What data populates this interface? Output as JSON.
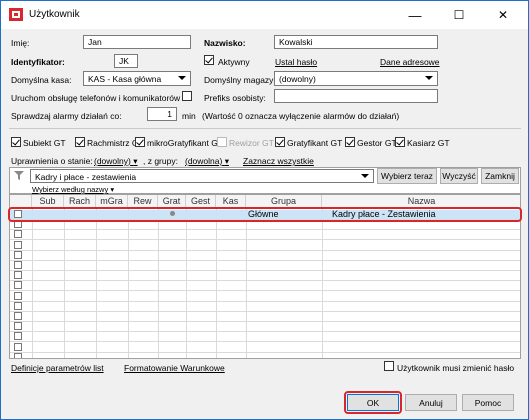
{
  "window": {
    "title": "Użytkownik",
    "minimize": "—",
    "maximize": "☐",
    "close": "✕"
  },
  "form": {
    "imie_label": "Imię:",
    "imie_value": "Jan",
    "nazwisko_label": "Nazwisko:",
    "nazwisko_value": "Kowalski",
    "identyfikator_label": "Identyfikator:",
    "identyfikator_value": "JK",
    "aktywny_label": "Aktywny",
    "ustal_haslo": "Ustal hasło",
    "dane_adresowe": "Dane adresowe",
    "kasa_label": "Domyślna kasa:",
    "kasa_value": "KAS - Kasa główna",
    "magazyn_label": "Domyślny magazyn:",
    "magazyn_value": "(dowolny)",
    "telefonia_label": "Uruchom obsługę telefonów i komunikatorów",
    "prefiks_label": "Prefiks osobisty:",
    "alarmy_label": "Sprawdzaj alarmy działań co:",
    "alarmy_value": "1",
    "alarmy_unit": "min",
    "alarmy_note": "(Wartość 0 oznacza wyłączenie alarmów do działań)"
  },
  "modules": [
    {
      "label": "Subiekt GT",
      "checked": true,
      "disabled": false
    },
    {
      "label": "Rachmistrz GT",
      "checked": true,
      "disabled": false
    },
    {
      "label": "mikroGratyfikant GT",
      "checked": true,
      "disabled": false
    },
    {
      "label": "Rewizor GT",
      "checked": false,
      "disabled": true
    },
    {
      "label": "Gratyfikant GT",
      "checked": true,
      "disabled": false
    },
    {
      "label": "Gestor GT",
      "checked": true,
      "disabled": false
    },
    {
      "label": "Kasiarz GT",
      "checked": true,
      "disabled": false
    }
  ],
  "permissions": {
    "stan_label": "Uprawnienia o stanie:",
    "stan_value": "(dowolny)",
    "grupa_label": ", z grupy:",
    "grupa_value": "(dowolna)",
    "zaznacz": "Zaznacz wszystkie",
    "filter_value": "Kadry i płace - zestawienia",
    "wybierz_teraz": "Wybierz teraz",
    "wyczysc": "Wyczyść",
    "zamknij": "Zamknij",
    "wybierz_wedlug": "Wybierz według nazwy"
  },
  "grid": {
    "columns": [
      "Sub",
      "Rach",
      "mGra",
      "Rew",
      "Grat",
      "Gest",
      "Kas",
      "Grupa",
      "Nazwa"
    ],
    "rows": [
      {
        "grupa": "Główne",
        "nazwa": "Kadry płace - Zestawienia"
      }
    ],
    "empty_rows": 14
  },
  "footer": {
    "definicje": "Definicje parametrów list",
    "formatowanie": "Formatowanie Warunkowe",
    "musi_zmienic": "Użytkownik musi zmienić hasło",
    "ok": "OK",
    "anuluj": "Anuluj",
    "pomoc": "Pomoc"
  },
  "colors": {
    "highlight_border": "#d9262c",
    "selected_row": "#cce4f7",
    "window_border": "#1f6fc9"
  }
}
